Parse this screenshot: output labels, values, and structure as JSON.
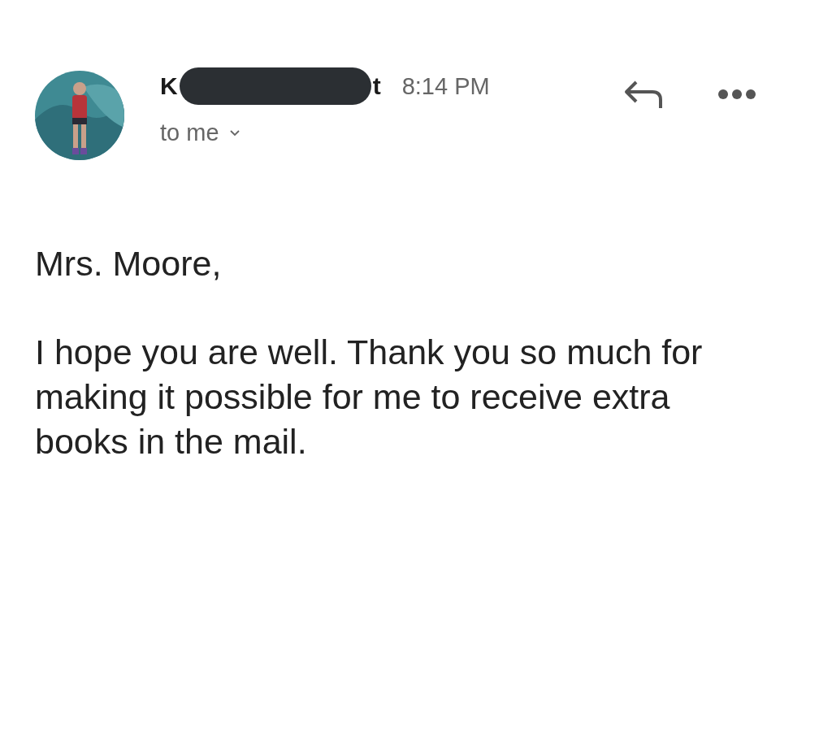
{
  "header": {
    "sender_visible_start": "K",
    "sender_visible_end": "t",
    "sender_redacted": true,
    "time": "8:14 PM",
    "recipient": "to me"
  },
  "body": {
    "greeting": "Mrs. Moore,",
    "paragraphs": [
      "I hope you are well. Thank you so much for making it possible for me to receive extra books in the mail."
    ]
  }
}
